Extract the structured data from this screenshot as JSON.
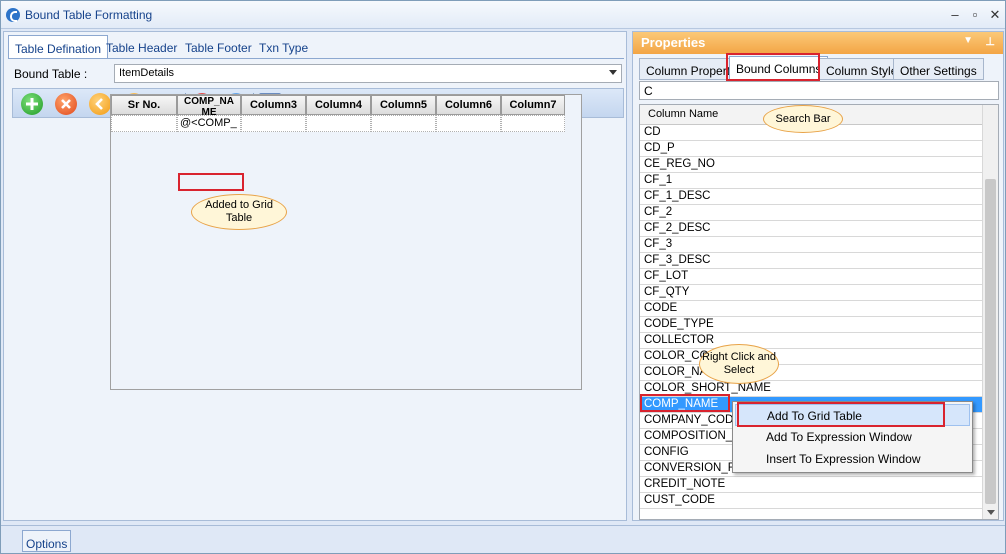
{
  "window": {
    "title": "Bound Table Formatting"
  },
  "left": {
    "tabs": [
      "Table Defination",
      "Table Header",
      "Table Footer",
      "Txn Type"
    ],
    "bound_table_label": "Bound Table :",
    "bound_table_value": "ItemDetails",
    "grid": {
      "headers": [
        "Sr No.",
        "COMP_NA ME",
        "Column3",
        "Column4",
        "Column5",
        "Column6",
        "Column7"
      ],
      "row": [
        "",
        "@<COMP_",
        "",
        "",
        "",
        "",
        ""
      ]
    },
    "callout_added": "Added to Grid Table"
  },
  "right": {
    "header": "Properties",
    "tabs": [
      "Column Property",
      "Bound Columns",
      "Column Style",
      "Other Settings"
    ],
    "search_value": "C",
    "list_header": "Column Name",
    "callout_search": "Search Bar",
    "callout_right_click": "Right Click and Select",
    "items": [
      "CD",
      "CD_P",
      "CE_REG_NO",
      "CF_1",
      "CF_1_DESC",
      "CF_2",
      "CF_2_DESC",
      "CF_3",
      "CF_3_DESC",
      "CF_LOT",
      "CF_QTY",
      "CODE",
      "CODE_TYPE",
      "COLLECTOR",
      "COLOR_COD",
      "COLOR_NA",
      "COLOR_SHORT_NAME",
      "COMP_NAME",
      "COMPANY_CODE",
      "COMPOSITION_D",
      "CONFIG",
      "CONVERSION_RA",
      "CREDIT_NOTE",
      "CUST_CODE"
    ],
    "context_menu": [
      "Add To Grid Table",
      "Add To Expression Window",
      "Insert To Expression Window"
    ]
  },
  "bottom": {
    "options_label": "Options"
  }
}
